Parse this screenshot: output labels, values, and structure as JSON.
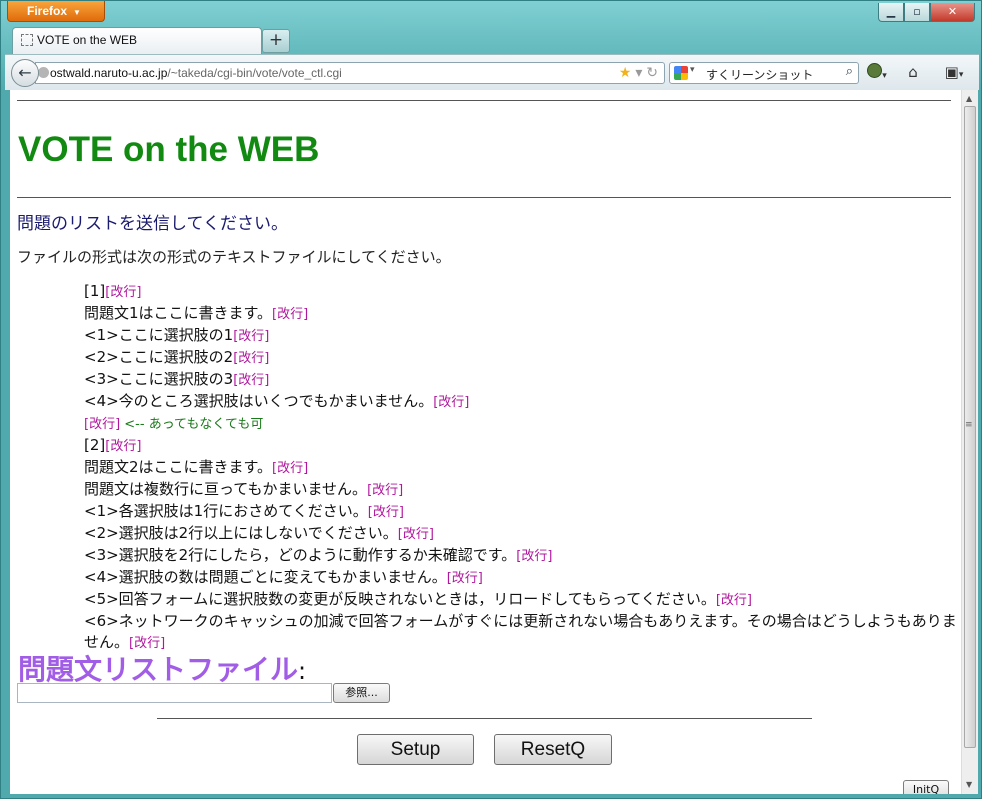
{
  "browser": {
    "app_button": "Firefox",
    "tab_title": "VOTE on the WEB",
    "url_host": "ostwald.naruto-u.ac.jp",
    "url_path": "/~takeda/cgi-bin/vote/vote_ctl.cgi",
    "search_text": "すくリーンショット"
  },
  "page": {
    "title": "VOTE on the WEB",
    "subheading": "問題のリストを送信してください。",
    "description": "ファイルの形式は次の形式のテキストファイルにしてください。",
    "sample_lines": [
      {
        "text": "[1]",
        "marker": "[改行]",
        "note": ""
      },
      {
        "text": "問題文1はここに書きます。",
        "marker": "[改行]",
        "note": ""
      },
      {
        "text": "<1>ここに選択肢の1",
        "marker": "[改行]",
        "note": ""
      },
      {
        "text": "<2>ここに選択肢の2",
        "marker": "[改行]",
        "note": ""
      },
      {
        "text": "<3>ここに選択肢の3",
        "marker": "[改行]",
        "note": ""
      },
      {
        "text": "<4>今のところ選択肢はいくつでもかまいません。",
        "marker": "[改行]",
        "note": ""
      },
      {
        "text": "",
        "marker": "[改行]",
        "note": " <-- あってもなくても可"
      },
      {
        "text": "[2]",
        "marker": "[改行]",
        "note": ""
      },
      {
        "text": "問題文2はここに書きます。",
        "marker": "[改行]",
        "note": ""
      },
      {
        "text": "問題文は複数行に亘ってもかまいません。",
        "marker": "[改行]",
        "note": ""
      },
      {
        "text": "<1>各選択肢は1行におさめてください。",
        "marker": "[改行]",
        "note": ""
      },
      {
        "text": "<2>選択肢は2行以上にはしないでください。",
        "marker": "[改行]",
        "note": ""
      },
      {
        "text": "<3>選択肢を2行にしたら，どのように動作するか未確認です。",
        "marker": "[改行]",
        "note": ""
      },
      {
        "text": "<4>選択肢の数は問題ごとに変えてもかまいません。",
        "marker": "[改行]",
        "note": ""
      },
      {
        "text": "<5>回答フォームに選択肢数の変更が反映されないときは，リロードしてもらってください。",
        "marker": "[改行]",
        "note": ""
      },
      {
        "text": "<6>ネットワークのキャッシュの加減で回答フォームがすぐには更新されない場合もありえます。その場合はどうしようもありません。",
        "marker": "[改行]",
        "note": ""
      }
    ],
    "file_label": "問題文リストファイル",
    "file_label_colon": ":",
    "browse_button": "参照...",
    "setup_button": "Setup",
    "reset_button": "ResetQ",
    "initq_button": "InitQ"
  }
}
